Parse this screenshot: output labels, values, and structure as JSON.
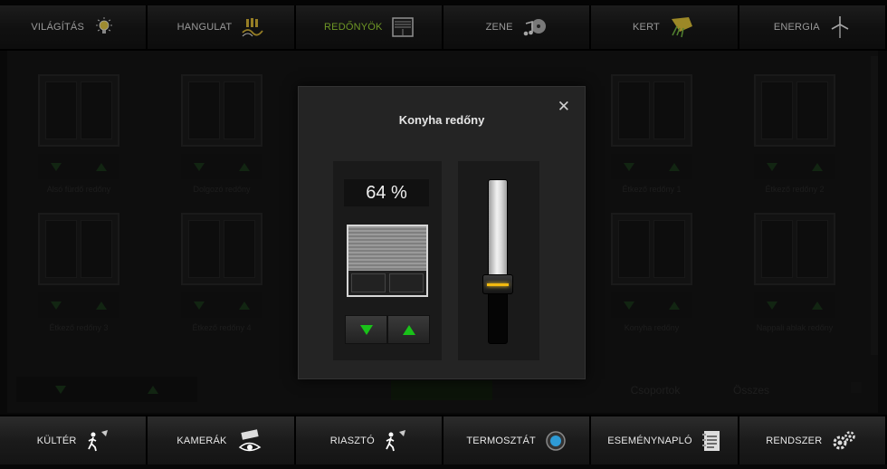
{
  "top_nav": [
    {
      "label": "VILÁGÍTÁS",
      "icon": "lightbulb-icon"
    },
    {
      "label": "HANGULAT",
      "icon": "mood-icon"
    },
    {
      "label": "REDŐNYÖK",
      "icon": "shutter-icon",
      "active": true
    },
    {
      "label": "ZENE",
      "icon": "music-icon"
    },
    {
      "label": "KERT",
      "icon": "garden-icon"
    },
    {
      "label": "ENERGIA",
      "icon": "wind-turbine-icon"
    }
  ],
  "bottom_nav": [
    {
      "label": "KÜLTÉR",
      "icon": "motion-sensor-icon"
    },
    {
      "label": "KAMERÁK",
      "icon": "camera-icon"
    },
    {
      "label": "RIASZTÓ",
      "icon": "alarm-icon"
    },
    {
      "label": "TERMOSZTÁT",
      "icon": "thermostat-icon"
    },
    {
      "label": "ESEMÉNYNAPLÓ",
      "icon": "event-log-icon"
    },
    {
      "label": "RENDSZER",
      "icon": "gears-icon"
    }
  ],
  "background_tiles": [
    {
      "label": "Alsó fürdő redőny"
    },
    {
      "label": "Dolgozó redőny"
    },
    {
      "label": "Étkező redőny 1"
    },
    {
      "label": "Étkező redőny 2"
    },
    {
      "label": "Étkező redőny 3"
    },
    {
      "label": "Étkező redőny 4"
    },
    {
      "label": "Konyha redőny"
    },
    {
      "label": "Nappali ablak redőny"
    }
  ],
  "filter_bar": {
    "groups_label": "Csoportok",
    "all_label": "Összes"
  },
  "dialog": {
    "title": "Konyha redőny",
    "close_symbol": "✕",
    "position_text": "64 %",
    "position_fraction": 0.64,
    "slider_fill_fraction": 0.64
  },
  "colors": {
    "active_tab": "#a8e63a",
    "arrow_green": "#19c219",
    "slider_indicator": "#f2b90f"
  }
}
